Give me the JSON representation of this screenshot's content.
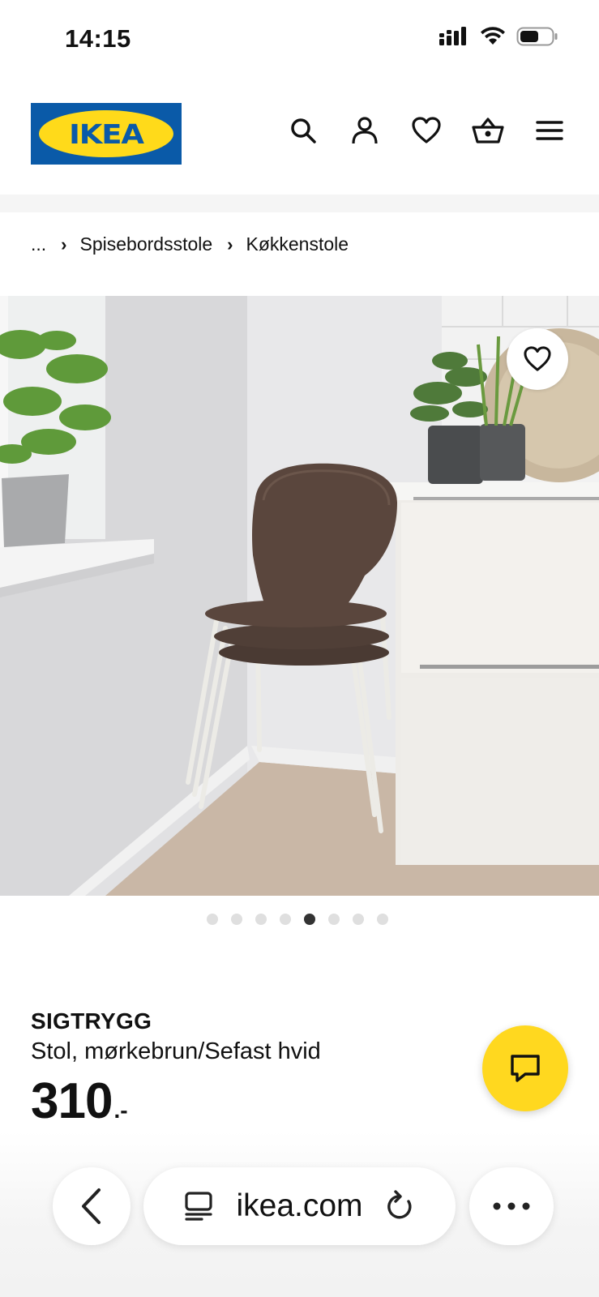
{
  "status_bar": {
    "time": "14:15"
  },
  "header": {
    "logo_text": "IKEA",
    "colors": {
      "logo_blue": "#0a5aa8",
      "logo_yellow": "#ffda1a"
    },
    "icons": [
      "search-icon",
      "account-icon",
      "heart-icon",
      "basket-icon",
      "menu-icon"
    ]
  },
  "breadcrumb": {
    "ellipsis": "...",
    "items": [
      "Spisebordsstole",
      "Køkkenstole"
    ]
  },
  "gallery": {
    "image_count": 8,
    "active_index": 4
  },
  "product": {
    "name": "SIGTRYGG",
    "description": "Stol, mørkebrun/Sefast hvid",
    "price": "310",
    "price_suffix": ".-"
  },
  "chat": {
    "color": "#ffd81f",
    "icon": "chat-icon"
  },
  "browser": {
    "url": "ikea.com",
    "icons": [
      "back-icon",
      "tabs-icon",
      "reload-icon",
      "more-icon"
    ]
  }
}
